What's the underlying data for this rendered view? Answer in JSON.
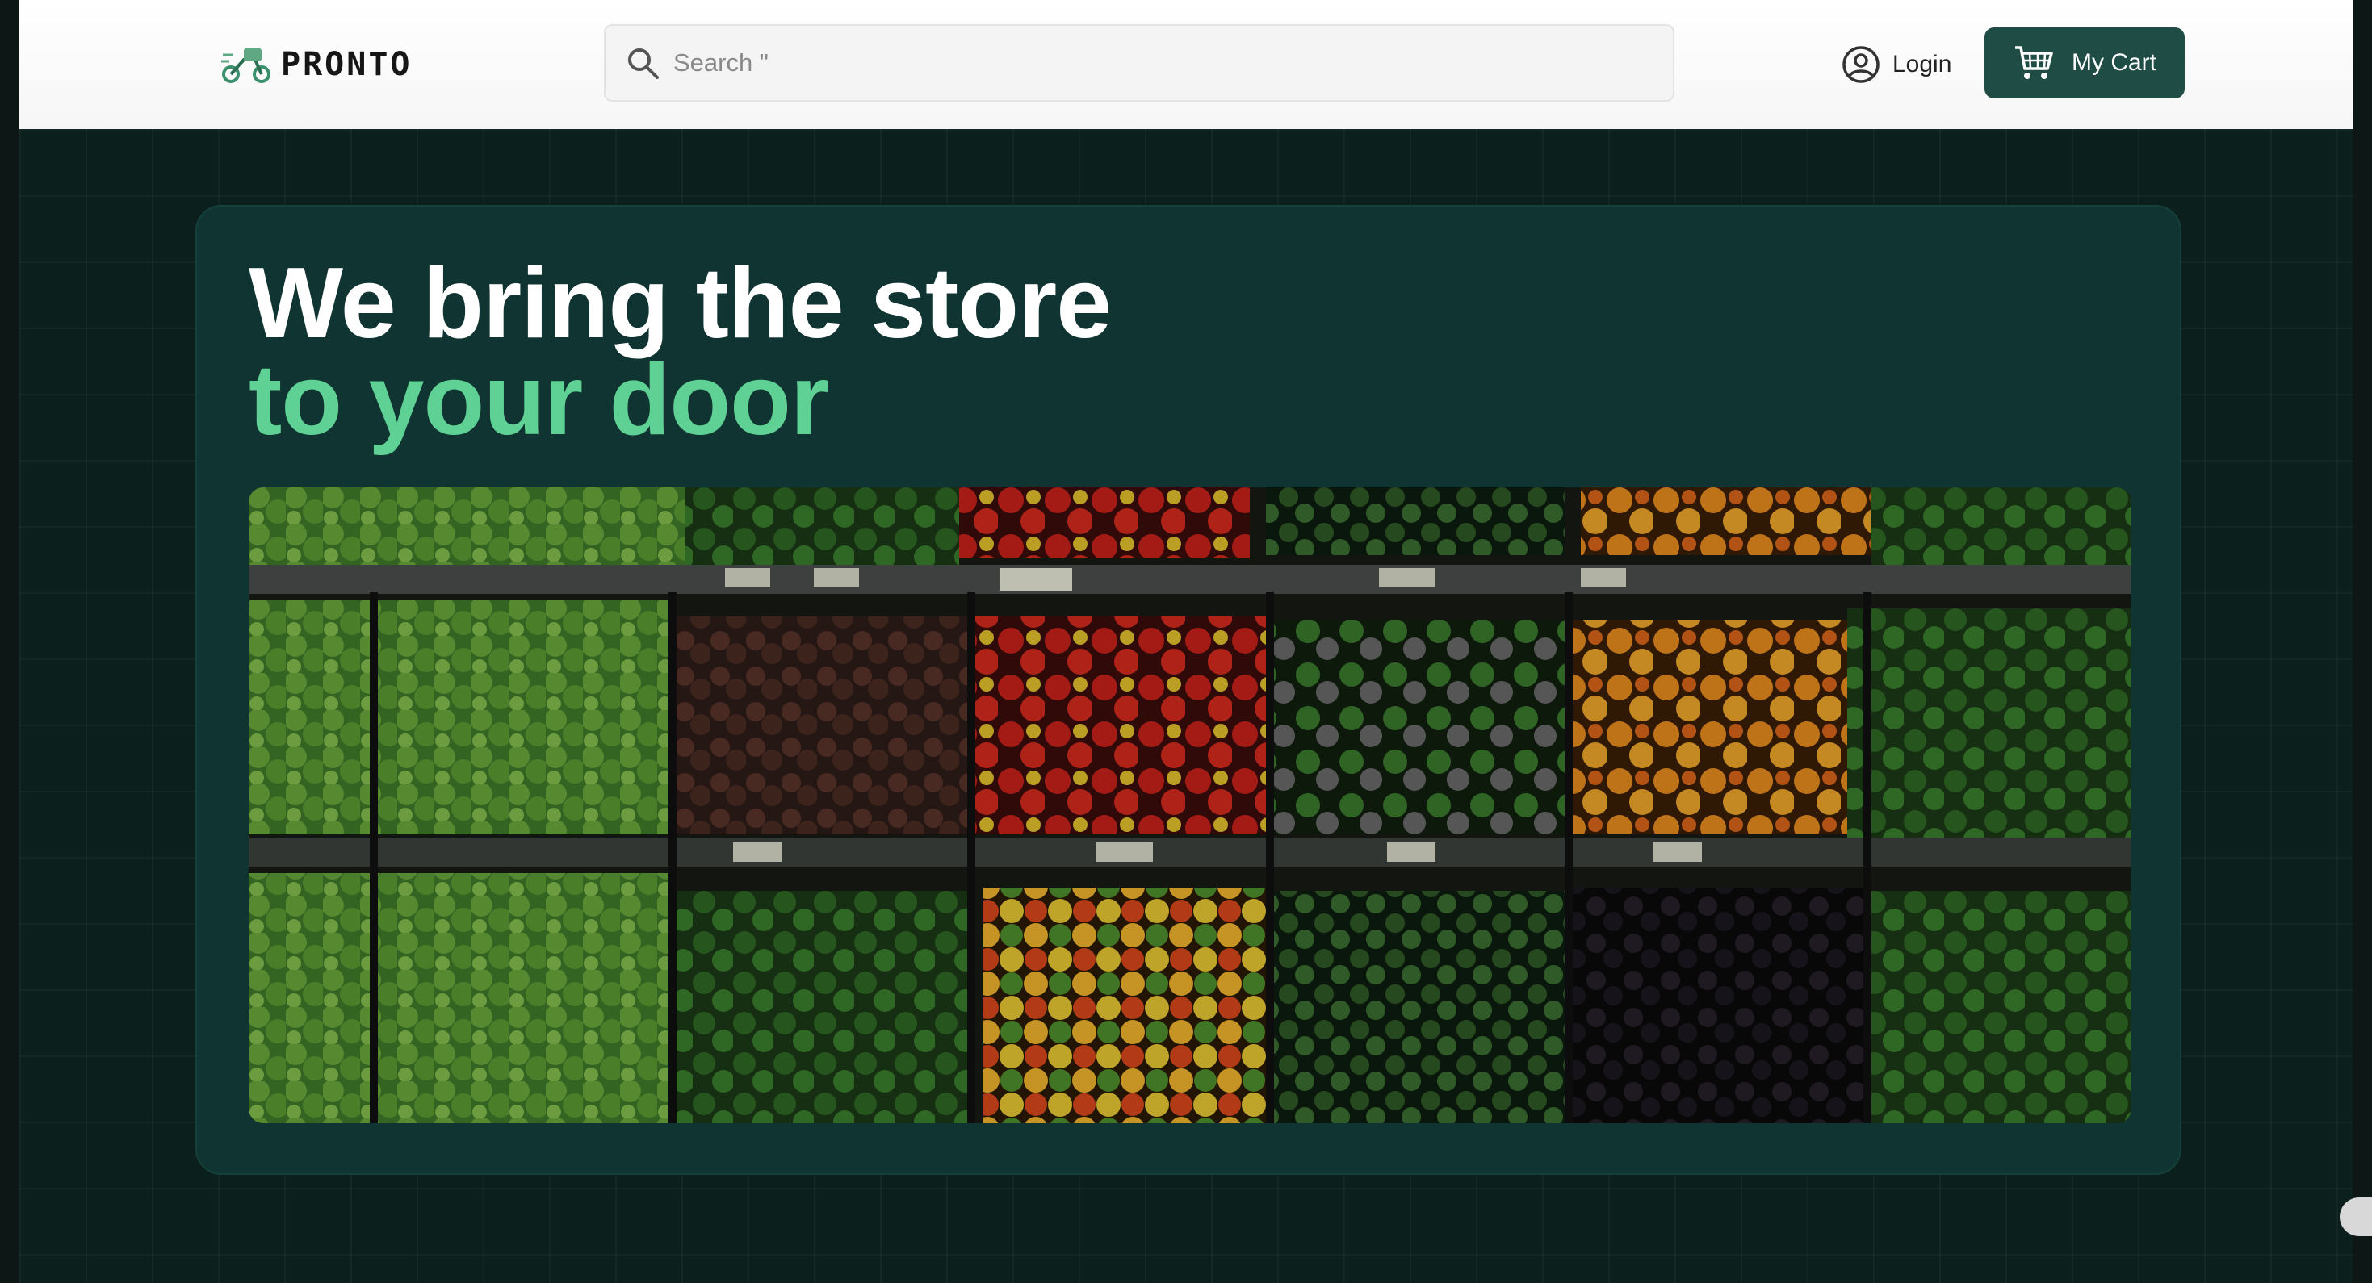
{
  "header": {
    "logo_text": "PRONTO",
    "logo_icon": "scooter-icon",
    "search": {
      "placeholder": "Search \"",
      "icon": "search-icon"
    },
    "login": {
      "label": "Login",
      "icon": "user-circle-icon"
    },
    "cart": {
      "label": "My Cart",
      "icon": "cart-icon"
    }
  },
  "hero": {
    "headline_line1": "We bring the store",
    "headline_line2": "to your door",
    "image_subject": "grocery-produce-shelves-photo"
  },
  "colors": {
    "page_background": "#0b1f1d",
    "hero_panel": "#103431",
    "accent_green": "#5fd195",
    "cart_button": "#1f4d45",
    "header_background": "#ffffff"
  }
}
